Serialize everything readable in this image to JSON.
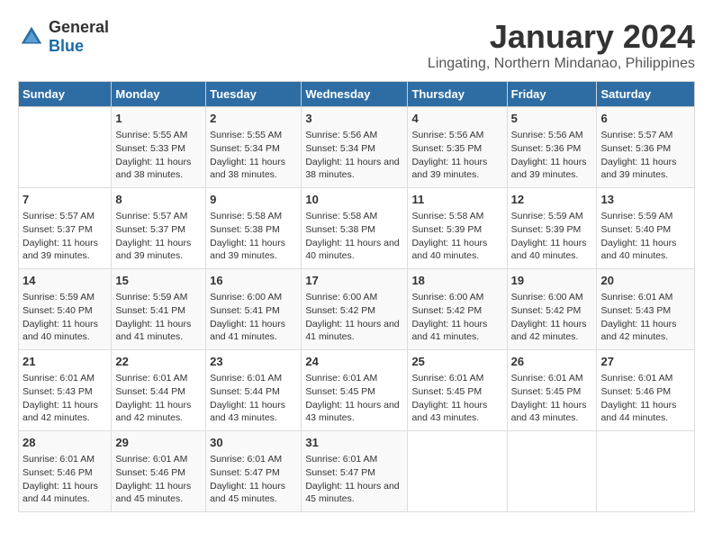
{
  "header": {
    "logo_general": "General",
    "logo_blue": "Blue",
    "month_year": "January 2024",
    "location": "Lingating, Northern Mindanao, Philippines"
  },
  "days_of_week": [
    "Sunday",
    "Monday",
    "Tuesday",
    "Wednesday",
    "Thursday",
    "Friday",
    "Saturday"
  ],
  "weeks": [
    [
      {
        "day": "",
        "sunrise": "",
        "sunset": "",
        "daylight": ""
      },
      {
        "day": "1",
        "sunrise": "Sunrise: 5:55 AM",
        "sunset": "Sunset: 5:33 PM",
        "daylight": "Daylight: 11 hours and 38 minutes."
      },
      {
        "day": "2",
        "sunrise": "Sunrise: 5:55 AM",
        "sunset": "Sunset: 5:34 PM",
        "daylight": "Daylight: 11 hours and 38 minutes."
      },
      {
        "day": "3",
        "sunrise": "Sunrise: 5:56 AM",
        "sunset": "Sunset: 5:34 PM",
        "daylight": "Daylight: 11 hours and 38 minutes."
      },
      {
        "day": "4",
        "sunrise": "Sunrise: 5:56 AM",
        "sunset": "Sunset: 5:35 PM",
        "daylight": "Daylight: 11 hours and 39 minutes."
      },
      {
        "day": "5",
        "sunrise": "Sunrise: 5:56 AM",
        "sunset": "Sunset: 5:36 PM",
        "daylight": "Daylight: 11 hours and 39 minutes."
      },
      {
        "day": "6",
        "sunrise": "Sunrise: 5:57 AM",
        "sunset": "Sunset: 5:36 PM",
        "daylight": "Daylight: 11 hours and 39 minutes."
      }
    ],
    [
      {
        "day": "7",
        "sunrise": "Sunrise: 5:57 AM",
        "sunset": "Sunset: 5:37 PM",
        "daylight": "Daylight: 11 hours and 39 minutes."
      },
      {
        "day": "8",
        "sunrise": "Sunrise: 5:57 AM",
        "sunset": "Sunset: 5:37 PM",
        "daylight": "Daylight: 11 hours and 39 minutes."
      },
      {
        "day": "9",
        "sunrise": "Sunrise: 5:58 AM",
        "sunset": "Sunset: 5:38 PM",
        "daylight": "Daylight: 11 hours and 39 minutes."
      },
      {
        "day": "10",
        "sunrise": "Sunrise: 5:58 AM",
        "sunset": "Sunset: 5:38 PM",
        "daylight": "Daylight: 11 hours and 40 minutes."
      },
      {
        "day": "11",
        "sunrise": "Sunrise: 5:58 AM",
        "sunset": "Sunset: 5:39 PM",
        "daylight": "Daylight: 11 hours and 40 minutes."
      },
      {
        "day": "12",
        "sunrise": "Sunrise: 5:59 AM",
        "sunset": "Sunset: 5:39 PM",
        "daylight": "Daylight: 11 hours and 40 minutes."
      },
      {
        "day": "13",
        "sunrise": "Sunrise: 5:59 AM",
        "sunset": "Sunset: 5:40 PM",
        "daylight": "Daylight: 11 hours and 40 minutes."
      }
    ],
    [
      {
        "day": "14",
        "sunrise": "Sunrise: 5:59 AM",
        "sunset": "Sunset: 5:40 PM",
        "daylight": "Daylight: 11 hours and 40 minutes."
      },
      {
        "day": "15",
        "sunrise": "Sunrise: 5:59 AM",
        "sunset": "Sunset: 5:41 PM",
        "daylight": "Daylight: 11 hours and 41 minutes."
      },
      {
        "day": "16",
        "sunrise": "Sunrise: 6:00 AM",
        "sunset": "Sunset: 5:41 PM",
        "daylight": "Daylight: 11 hours and 41 minutes."
      },
      {
        "day": "17",
        "sunrise": "Sunrise: 6:00 AM",
        "sunset": "Sunset: 5:42 PM",
        "daylight": "Daylight: 11 hours and 41 minutes."
      },
      {
        "day": "18",
        "sunrise": "Sunrise: 6:00 AM",
        "sunset": "Sunset: 5:42 PM",
        "daylight": "Daylight: 11 hours and 41 minutes."
      },
      {
        "day": "19",
        "sunrise": "Sunrise: 6:00 AM",
        "sunset": "Sunset: 5:42 PM",
        "daylight": "Daylight: 11 hours and 42 minutes."
      },
      {
        "day": "20",
        "sunrise": "Sunrise: 6:01 AM",
        "sunset": "Sunset: 5:43 PM",
        "daylight": "Daylight: 11 hours and 42 minutes."
      }
    ],
    [
      {
        "day": "21",
        "sunrise": "Sunrise: 6:01 AM",
        "sunset": "Sunset: 5:43 PM",
        "daylight": "Daylight: 11 hours and 42 minutes."
      },
      {
        "day": "22",
        "sunrise": "Sunrise: 6:01 AM",
        "sunset": "Sunset: 5:44 PM",
        "daylight": "Daylight: 11 hours and 42 minutes."
      },
      {
        "day": "23",
        "sunrise": "Sunrise: 6:01 AM",
        "sunset": "Sunset: 5:44 PM",
        "daylight": "Daylight: 11 hours and 43 minutes."
      },
      {
        "day": "24",
        "sunrise": "Sunrise: 6:01 AM",
        "sunset": "Sunset: 5:45 PM",
        "daylight": "Daylight: 11 hours and 43 minutes."
      },
      {
        "day": "25",
        "sunrise": "Sunrise: 6:01 AM",
        "sunset": "Sunset: 5:45 PM",
        "daylight": "Daylight: 11 hours and 43 minutes."
      },
      {
        "day": "26",
        "sunrise": "Sunrise: 6:01 AM",
        "sunset": "Sunset: 5:45 PM",
        "daylight": "Daylight: 11 hours and 43 minutes."
      },
      {
        "day": "27",
        "sunrise": "Sunrise: 6:01 AM",
        "sunset": "Sunset: 5:46 PM",
        "daylight": "Daylight: 11 hours and 44 minutes."
      }
    ],
    [
      {
        "day": "28",
        "sunrise": "Sunrise: 6:01 AM",
        "sunset": "Sunset: 5:46 PM",
        "daylight": "Daylight: 11 hours and 44 minutes."
      },
      {
        "day": "29",
        "sunrise": "Sunrise: 6:01 AM",
        "sunset": "Sunset: 5:46 PM",
        "daylight": "Daylight: 11 hours and 45 minutes."
      },
      {
        "day": "30",
        "sunrise": "Sunrise: 6:01 AM",
        "sunset": "Sunset: 5:47 PM",
        "daylight": "Daylight: 11 hours and 45 minutes."
      },
      {
        "day": "31",
        "sunrise": "Sunrise: 6:01 AM",
        "sunset": "Sunset: 5:47 PM",
        "daylight": "Daylight: 11 hours and 45 minutes."
      },
      {
        "day": "",
        "sunrise": "",
        "sunset": "",
        "daylight": ""
      },
      {
        "day": "",
        "sunrise": "",
        "sunset": "",
        "daylight": ""
      },
      {
        "day": "",
        "sunrise": "",
        "sunset": "",
        "daylight": ""
      }
    ]
  ]
}
